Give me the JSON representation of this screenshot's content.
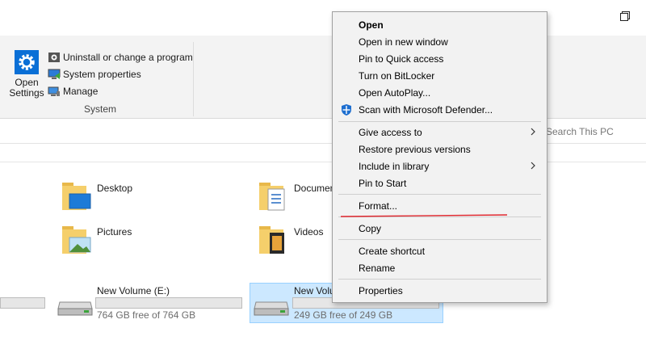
{
  "ribbon": {
    "open_settings": "Open\nSettings",
    "commands": {
      "uninstall": "Uninstall or change a program",
      "system_properties": "System properties",
      "manage": "Manage"
    },
    "group_label": "System"
  },
  "search": {
    "placeholder": "Search This PC"
  },
  "folders": {
    "desktop": "Desktop",
    "documents": "Documen",
    "pictures": "Pictures",
    "videos": "Videos"
  },
  "drives": [
    {
      "name": "New Volume (E:)",
      "free_text": "764 GB free of 764 GB",
      "used_fraction": 0.0
    },
    {
      "name": "New Volu",
      "free_text": "249 GB free of 249 GB",
      "used_fraction": 0.0
    }
  ],
  "context_menu": {
    "items": [
      {
        "label": "Open"
      },
      {
        "label": "Open in new window"
      },
      {
        "label": "Pin to Quick access"
      },
      {
        "label": "Turn on BitLocker"
      },
      {
        "label": "Open AutoPlay..."
      },
      {
        "label": "Scan with Microsoft Defender..."
      },
      {
        "label": "Give access to"
      },
      {
        "label": "Restore previous versions"
      },
      {
        "label": "Include in library"
      },
      {
        "label": "Pin to Start"
      },
      {
        "label": "Format..."
      },
      {
        "label": "Copy"
      },
      {
        "label": "Create shortcut"
      },
      {
        "label": "Rename"
      },
      {
        "label": "Properties"
      }
    ]
  },
  "colors": {
    "accent": "#0a6fd6",
    "selection": "#cce8ff",
    "annotation": "#e0282f"
  }
}
